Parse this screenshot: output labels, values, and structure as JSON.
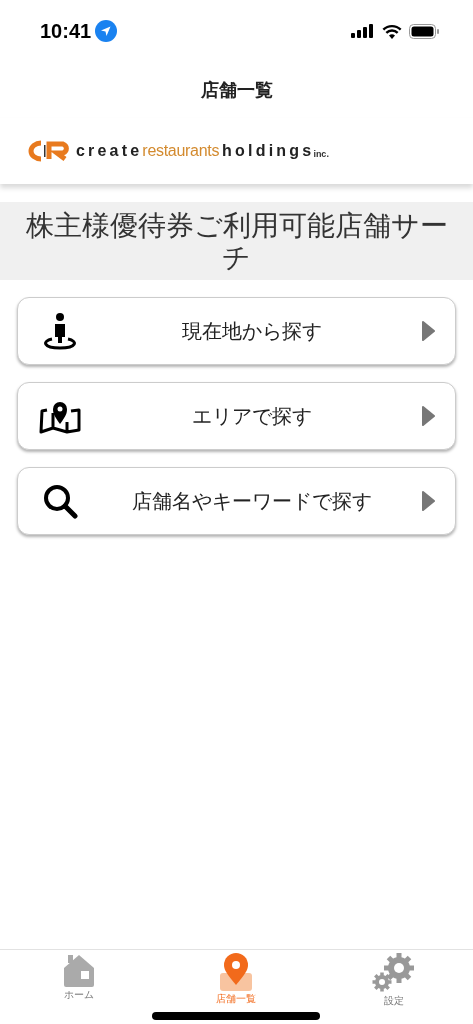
{
  "status_bar": {
    "time": "10:41"
  },
  "nav": {
    "title": "店舗一覧"
  },
  "logo": {
    "parts": [
      {
        "text": "create",
        "kind": "bold"
      },
      {
        "text": "restaurants",
        "kind": "light"
      },
      {
        "text": "holdings",
        "kind": "bold"
      },
      {
        "text": "inc.",
        "kind": "small"
      }
    ]
  },
  "banner": {
    "title": "株主様優待券ご利用可能店舗サーチ"
  },
  "options": [
    {
      "label": "現在地から探す",
      "kind": "location"
    },
    {
      "label": "エリアで探す",
      "kind": "map"
    },
    {
      "label": "店舗名やキーワードで探す",
      "kind": "search"
    }
  ],
  "tab_bar": [
    {
      "label": "ホーム",
      "kind": "home",
      "selected": false
    },
    {
      "label": "店舗一覧",
      "kind": "pin",
      "selected": true
    },
    {
      "label": "設定",
      "kind": "settings",
      "selected": false
    }
  ]
}
